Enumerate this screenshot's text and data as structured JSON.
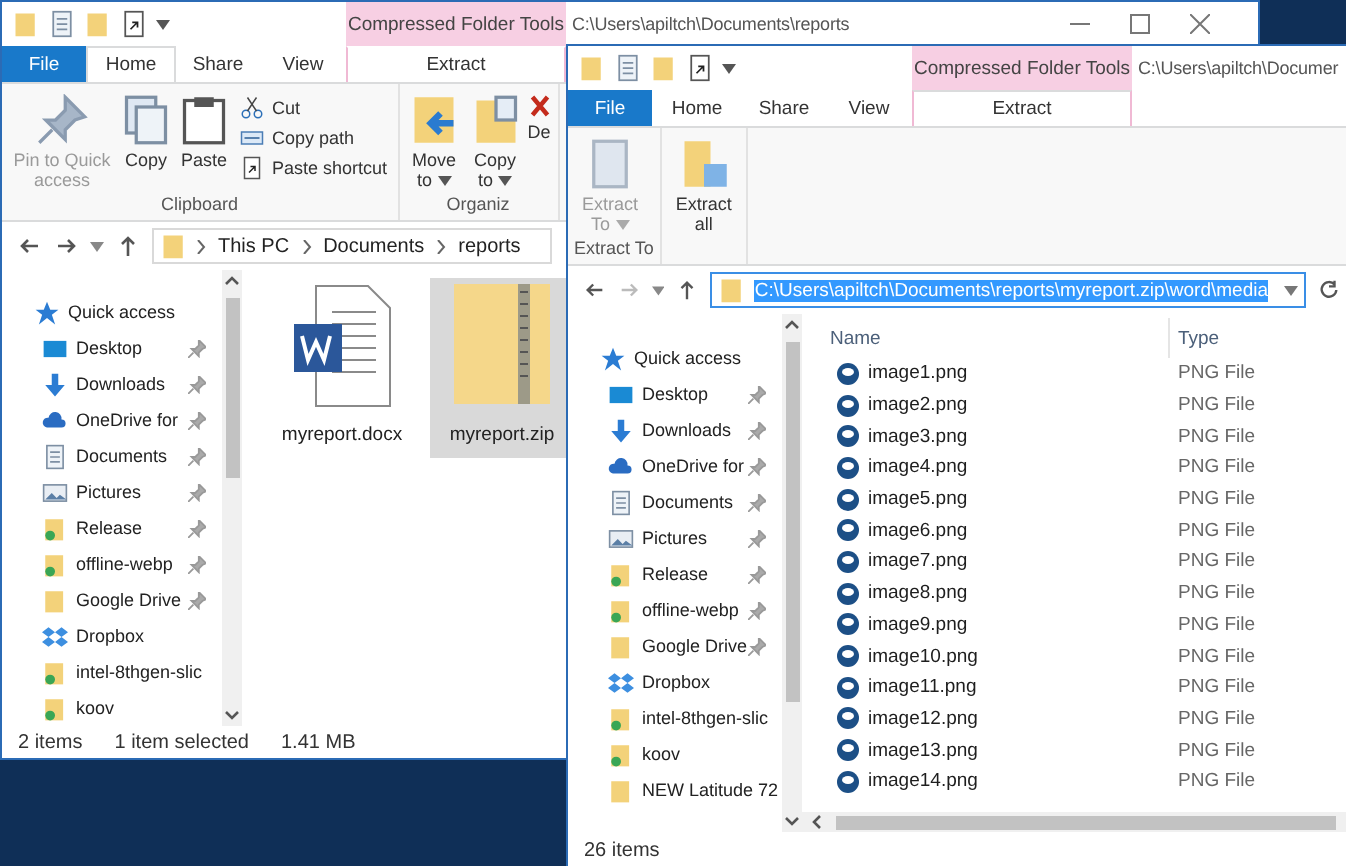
{
  "back_window": {
    "title": "C:\\Users\\apiltch\\Documents\\reports",
    "context_header": "Compressed Folder Tools",
    "tabs": [
      {
        "label": "File",
        "kind": "file",
        "selected": false
      },
      {
        "label": "Home",
        "kind": "main",
        "selected": true
      },
      {
        "label": "Share",
        "kind": "main",
        "selected": false
      },
      {
        "label": "View",
        "kind": "main",
        "selected": false
      },
      {
        "label": "Extract",
        "kind": "context",
        "selected": false
      }
    ],
    "ribbon": [
      {
        "label": "Clipboard",
        "commands": [
          {
            "label": "Pin to Quick access",
            "kind": "pin",
            "disabled": true,
            "dropdown": false
          },
          {
            "label": "Copy",
            "kind": "copy",
            "disabled": false,
            "dropdown": false
          },
          {
            "label": "Paste",
            "kind": "paste",
            "disabled": false,
            "dropdown": false
          },
          {
            "stack": [
              {
                "label": "Cut",
                "kind": "cut",
                "disabled": false
              },
              {
                "label": "Copy path",
                "kind": "copy-path",
                "disabled": false
              },
              {
                "label": "Paste shortcut",
                "kind": "paste-shortcut",
                "disabled": false
              }
            ]
          }
        ]
      },
      {
        "label": "Organiz",
        "commands": [
          {
            "label": "Move to",
            "kind": "move-to",
            "disabled": false,
            "dropdown": true
          },
          {
            "label": "Copy to",
            "kind": "copy-to",
            "disabled": false,
            "dropdown": true
          },
          {
            "label": "De",
            "kind": "delete",
            "disabled": false
          }
        ]
      }
    ],
    "breadcrumbs": [
      "This PC",
      "Documents",
      "reports"
    ],
    "navigation": [
      {
        "label": "Quick access",
        "kind": "star",
        "pinned": false
      },
      {
        "label": "Desktop",
        "kind": "desktop",
        "pinned": true
      },
      {
        "label": "Downloads",
        "kind": "download",
        "pinned": true
      },
      {
        "label": "OneDrive for",
        "kind": "cloud",
        "pinned": true
      },
      {
        "label": "Documents",
        "kind": "documents",
        "pinned": true
      },
      {
        "label": "Pictures",
        "kind": "pictures",
        "pinned": true
      },
      {
        "label": "Release",
        "kind": "synced-folder",
        "pinned": true
      },
      {
        "label": "offline-webp",
        "kind": "synced-folder",
        "pinned": true
      },
      {
        "label": "Google Drive",
        "kind": "folder",
        "pinned": true
      },
      {
        "label": "Dropbox",
        "kind": "dropbox",
        "pinned": false
      },
      {
        "label": "intel-8thgen-slic",
        "kind": "synced-folder",
        "pinned": false
      },
      {
        "label": "koov",
        "kind": "synced-folder",
        "pinned": false
      }
    ],
    "files": [
      {
        "name": "myreport.docx",
        "kind": "word",
        "selected": false
      },
      {
        "name": "myreport.zip",
        "kind": "zip",
        "selected": true
      }
    ],
    "status": [
      "2 items",
      "1 item selected",
      "1.41 MB"
    ]
  },
  "front_window": {
    "title": "C:\\Users\\apiltch\\Documer",
    "context_header": "Compressed Folder Tools",
    "tabs": [
      {
        "label": "File",
        "kind": "file",
        "selected": false
      },
      {
        "label": "Home",
        "kind": "main",
        "selected": false
      },
      {
        "label": "Share",
        "kind": "main",
        "selected": false
      },
      {
        "label": "View",
        "kind": "main",
        "selected": false
      },
      {
        "label": "Extract",
        "kind": "context",
        "selected": true
      }
    ],
    "ribbon": [
      {
        "label": "Extract To",
        "commands": [
          {
            "label": "Extract To",
            "kind": "extract-to",
            "disabled": true,
            "dropdown": true
          }
        ]
      },
      {
        "commands": [
          {
            "label": "Extract all",
            "kind": "extract-all",
            "disabled": false,
            "dropdown": false
          }
        ]
      }
    ],
    "address": {
      "value": "C:\\Users\\apiltch\\Documents\\reports\\myreport.zip\\word\\media",
      "text_selected": true
    },
    "navigation": [
      {
        "label": "Quick access",
        "kind": "star",
        "pinned": false
      },
      {
        "label": "Desktop",
        "kind": "desktop",
        "pinned": true
      },
      {
        "label": "Downloads",
        "kind": "download",
        "pinned": true
      },
      {
        "label": "OneDrive for",
        "kind": "cloud",
        "pinned": true
      },
      {
        "label": "Documents",
        "kind": "documents",
        "pinned": true
      },
      {
        "label": "Pictures",
        "kind": "pictures",
        "pinned": true
      },
      {
        "label": "Release",
        "kind": "synced-folder",
        "pinned": true
      },
      {
        "label": "offline-webp",
        "kind": "synced-folder",
        "pinned": true
      },
      {
        "label": "Google Drive",
        "kind": "folder",
        "pinned": true
      },
      {
        "label": "Dropbox",
        "kind": "dropbox",
        "pinned": false
      },
      {
        "label": "intel-8thgen-slic",
        "kind": "synced-folder",
        "pinned": false
      },
      {
        "label": "koov",
        "kind": "synced-folder",
        "pinned": false
      },
      {
        "label": "NEW Latitude 72",
        "kind": "folder",
        "pinned": false
      }
    ],
    "columns": [
      "Name",
      "Type"
    ],
    "rows": [
      {
        "name": "image1.png",
        "type": "PNG File"
      },
      {
        "name": "image2.png",
        "type": "PNG File"
      },
      {
        "name": "image3.png",
        "type": "PNG File"
      },
      {
        "name": "image4.png",
        "type": "PNG File"
      },
      {
        "name": "image5.png",
        "type": "PNG File"
      },
      {
        "name": "image6.png",
        "type": "PNG File"
      },
      {
        "name": "image7.png",
        "type": "PNG File"
      },
      {
        "name": "image8.png",
        "type": "PNG File"
      },
      {
        "name": "image9.png",
        "type": "PNG File"
      },
      {
        "name": "image10.png",
        "type": "PNG File"
      },
      {
        "name": "image11.png",
        "type": "PNG File"
      },
      {
        "name": "image12.png",
        "type": "PNG File"
      },
      {
        "name": "image13.png",
        "type": "PNG File"
      },
      {
        "name": "image14.png",
        "type": "PNG File"
      }
    ],
    "status": [
      "26 items"
    ]
  }
}
